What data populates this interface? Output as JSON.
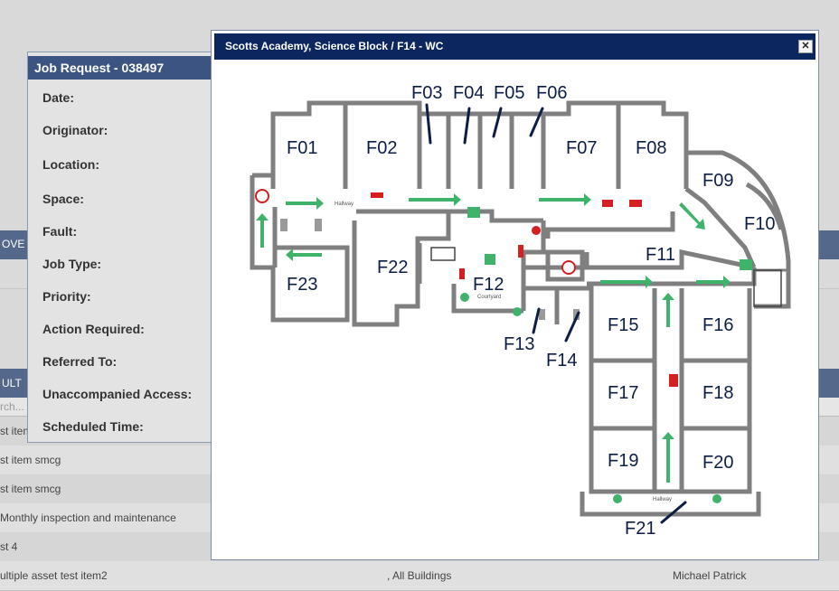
{
  "background": {
    "tab_label": "OVE",
    "table_head_label": "ULT",
    "search_placeholder": "rch...",
    "rows": [
      {
        "c1": "st item",
        "c2": "",
        "c3": ""
      },
      {
        "c1": "st item smcg",
        "c2": "",
        "c3": ""
      },
      {
        "c1": "st item smcg",
        "c2": "",
        "c3": ""
      },
      {
        "c1": "Monthly inspection and maintenance",
        "c2": "",
        "c3": ""
      },
      {
        "c1": "st 4",
        "c2": "",
        "c3": ""
      },
      {
        "c1": "ultiple asset test item2",
        "c2": ", All Buildings",
        "c3": "Michael Patrick"
      }
    ]
  },
  "job_request": {
    "title": "Job Request - 038497",
    "labels": [
      "Date:",
      "Originator:",
      "Location:",
      "Space:",
      "Fault:",
      "Job Type:",
      "Priority:",
      "Action Required:",
      "Referred To:",
      "Unaccompanied Access:",
      "Scheduled Time:"
    ]
  },
  "dialog": {
    "title": "Scotts Academy, Science Block / F14 - WC",
    "close_symbol": "✕"
  },
  "floor_plan": {
    "rooms": {
      "F01": "F01",
      "F02": "F02",
      "F03": "F03",
      "F04": "F04",
      "F05": "F05",
      "F06": "F06",
      "F07": "F07",
      "F08": "F08",
      "F09": "F09",
      "F10": "F10",
      "F11": "F11",
      "F12": "F12",
      "F13": "F13",
      "F14": "F14",
      "F15": "F15",
      "F16": "F16",
      "F17": "F17",
      "F18": "F18",
      "F19": "F19",
      "F20": "F20",
      "F21": "F21",
      "F22": "F22",
      "F23": "F23"
    },
    "small_labels": {
      "hallway_top": "Hallway",
      "courtyard": "Courtyard",
      "hallway_bottom": "Hallway"
    },
    "colors": {
      "arrow": "#3fb36a",
      "wall": "#7f7f7f",
      "label": "#0d1e46",
      "header": "#0c2660"
    }
  }
}
